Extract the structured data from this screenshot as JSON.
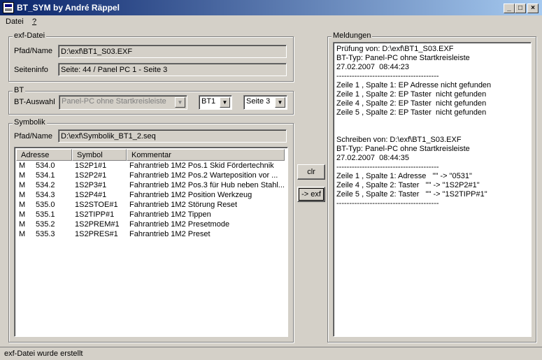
{
  "window": {
    "title": "BT_SYM by André Räppel"
  },
  "menu": {
    "items": [
      "Datei",
      "?"
    ]
  },
  "exf": {
    "group": "exf-Datei",
    "path_label": "Pfad/Name",
    "path_value": "D:\\exf\\BT1_S03.EXF",
    "info_label": "Seiteninfo",
    "info_value": "Seite: 44 / Panel PC 1 - Seite 3"
  },
  "bt": {
    "group": "BT",
    "select_label": "BT-Auswahl",
    "type_value": "Panel-PC ohne Startkreisleiste",
    "bt_value": "BT1",
    "page_value": "Seite 3"
  },
  "symbolik": {
    "group": "Symbolik",
    "path_label": "Pfad/Name",
    "path_value": "D:\\exf\\Symbolik_BT1_2.seq",
    "columns": [
      "Adresse",
      "Symbol",
      "Kommentar"
    ],
    "rows": [
      [
        "M",
        "534.0",
        "1S2P1#1",
        "Fahrantrieb 1M2 Pos.1 Skid Fördertechnik"
      ],
      [
        "M",
        "534.1",
        "1S2P2#1",
        "Fahrantrieb 1M2 Pos.2 Warteposition vor ..."
      ],
      [
        "M",
        "534.2",
        "1S2P3#1",
        "Fahrantrieb 1M2 Pos.3 für Hub neben Stahl..."
      ],
      [
        "M",
        "534.3",
        "1S2P4#1",
        "Fahrantrieb 1M2 Position Werkzeug"
      ],
      [
        "M",
        "535.0",
        "1S2STOE#1",
        "Fahrantrieb 1M2 Störung Reset"
      ],
      [
        "M",
        "535.1",
        "1S2TIPP#1",
        "Fahrantrieb 1M2 Tippen"
      ],
      [
        "M",
        "535.2",
        "1S2PREM#1",
        "Fahrantrieb 1M2 Presetmode"
      ],
      [
        "M",
        "535.3",
        "1S2PRES#1",
        "Fahrantrieb 1M2 Preset"
      ]
    ]
  },
  "buttons": {
    "clr": "clr",
    "to_exf": "-> exf"
  },
  "meldungen": {
    "group": "Meldungen",
    "lines": [
      "Prüfung von: D:\\exf\\BT1_S03.EXF",
      "BT-Typ: Panel-PC ohne Startkreisleiste",
      "27.02.2007  08:44:23",
      "----------------------------------------",
      "Zeile 1 , Spalte 1: EP Adresse nicht gefunden",
      "Zeile 1 , Spalte 2: EP Taster  nicht gefunden",
      "Zeile 4 , Spalte 2: EP Taster  nicht gefunden",
      "Zeile 5 , Spalte 2: EP Taster  nicht gefunden",
      "",
      "",
      "Schreiben von: D:\\exf\\BT1_S03.EXF",
      "BT-Typ: Panel-PC ohne Startkreisleiste",
      "27.02.2007  08:44:35",
      "----------------------------------------",
      "Zeile 1 , Spalte 1: Adresse   \"\" -> \"0531\"",
      "Zeile 4 , Spalte 2: Taster   \"\" -> \"1S2P2#1\"",
      "Zeile 5 , Spalte 2: Taster   \"\" -> \"1S2TIPP#1\"",
      "----------------------------------------"
    ]
  },
  "status": {
    "text": "exf-Datei wurde erstellt"
  }
}
